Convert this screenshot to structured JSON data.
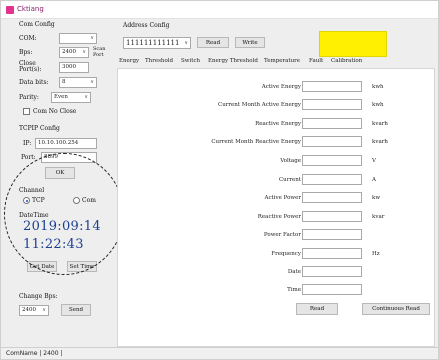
{
  "app": {
    "title": "Cktiang"
  },
  "com_config": {
    "title": "Com Config",
    "com_label": "COM:",
    "com_value": "",
    "bps_label": "Bps:",
    "bps_value": "2400",
    "scan_port": "Scan Port",
    "close_label": "Close Port(s):",
    "close_value": "3000",
    "data_bits_label": "Data bits:",
    "data_bits_value": "8",
    "parity_label": "Parity:",
    "parity_value": "Even",
    "nocom_close": "Com No Close"
  },
  "tcpip_config": {
    "title": "TCPIP Config",
    "ip_label": "IP:",
    "ip_value": "10.10.100.254",
    "port_label": "Port:",
    "port_value": "8899",
    "ok": "OK"
  },
  "channel": {
    "title": "Channel",
    "tcp": "TCP",
    "com": "Com",
    "selected": "TCP"
  },
  "datetime": {
    "title": "DateTime",
    "date": "2019:09:14",
    "time": "11:22:43"
  },
  "left_buttons": {
    "get_date": "Get Date",
    "set_time": "Set Time"
  },
  "change_bps": {
    "title": "Change Bps:",
    "value": "2400",
    "send": "Send"
  },
  "address_config": {
    "title": "Address Config",
    "address": "111111111111",
    "read": "Read",
    "write": "Write",
    "indicator_color": "#ffef00"
  },
  "tabs": [
    "Energy",
    "Threshold",
    "Switch",
    "Energy Threshold",
    "Temperature",
    "Fault",
    "Calibration"
  ],
  "energy_rows": [
    {
      "label": "Active Energy",
      "value": "",
      "unit": "kwh"
    },
    {
      "label": "Current Month Active Energy",
      "value": "",
      "unit": "kwh"
    },
    {
      "label": "Reactive Energy",
      "value": "",
      "unit": "kvarh"
    },
    {
      "label": "Current Month Reactive Energy",
      "value": "",
      "unit": "kvarh"
    },
    {
      "label": "Voltage",
      "value": "",
      "unit": "V"
    },
    {
      "label": "Current",
      "value": "",
      "unit": "A"
    },
    {
      "label": "Active Power",
      "value": "",
      "unit": "kw"
    },
    {
      "label": "Reactive Power",
      "value": "",
      "unit": "kvar"
    },
    {
      "label": "Power Factor",
      "value": "",
      "unit": ""
    },
    {
      "label": "Frequency",
      "value": "",
      "unit": "Hz"
    },
    {
      "label": "Date",
      "value": "",
      "unit": ""
    },
    {
      "label": "Time",
      "value": "",
      "unit": ""
    }
  ],
  "energy_buttons": {
    "read": "Read",
    "continuous_read": "Continuous Read"
  },
  "statusbar": {
    "port_name": "ComName",
    "bps": "2400"
  }
}
